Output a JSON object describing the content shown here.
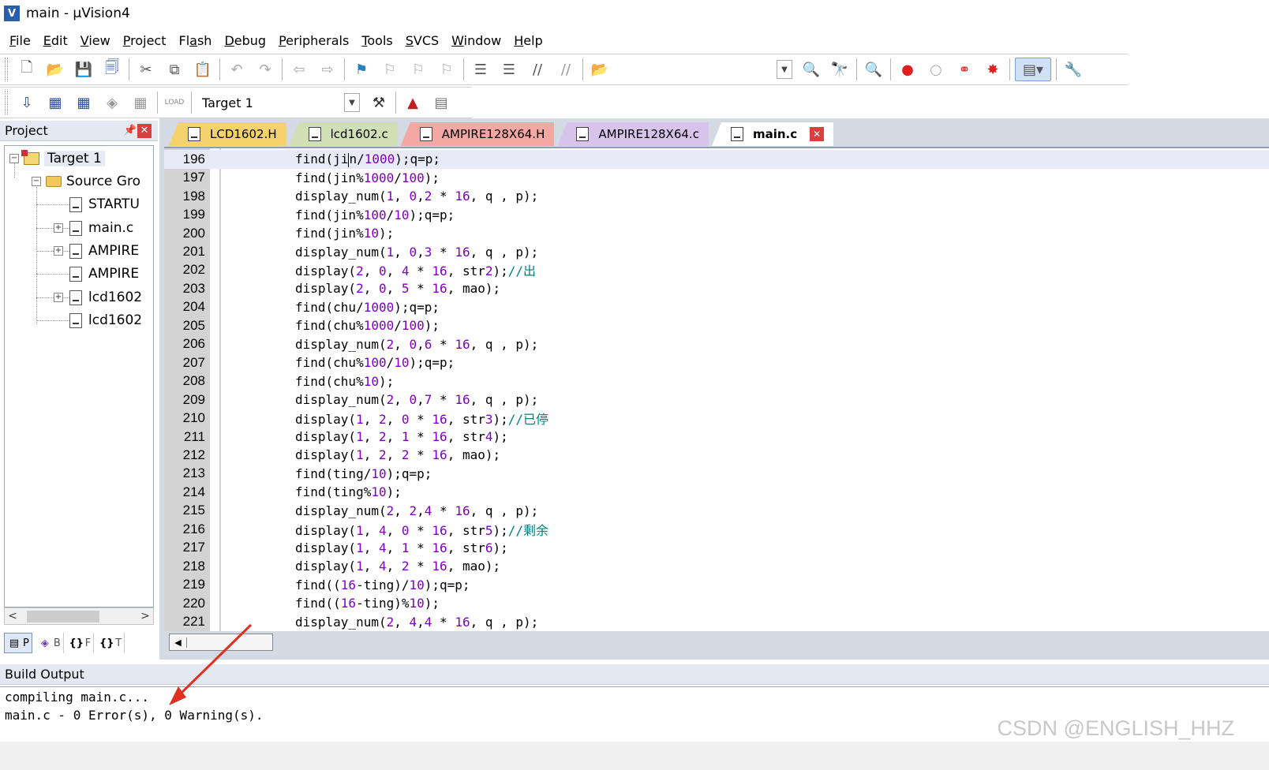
{
  "window": {
    "title": "main  - µVision4",
    "app_icon": "V"
  },
  "menu": [
    {
      "pre": "",
      "u": "F",
      "post": "ile"
    },
    {
      "pre": "",
      "u": "E",
      "post": "dit"
    },
    {
      "pre": "",
      "u": "V",
      "post": "iew"
    },
    {
      "pre": "",
      "u": "P",
      "post": "roject"
    },
    {
      "pre": "Fl",
      "u": "a",
      "post": "sh"
    },
    {
      "pre": "",
      "u": "D",
      "post": "ebug"
    },
    {
      "pre": "",
      "u": "P",
      "post": "eripherals"
    },
    {
      "pre": "",
      "u": "T",
      "post": "ools"
    },
    {
      "pre": "",
      "u": "S",
      "post": "VCS"
    },
    {
      "pre": "",
      "u": "W",
      "post": "indow"
    },
    {
      "pre": "",
      "u": "H",
      "post": "elp"
    }
  ],
  "toolbar2": {
    "target_select": "Target 1"
  },
  "project_panel": {
    "title": "Project",
    "tree": [
      {
        "label": "Target 1",
        "icon": "target-icon"
      },
      {
        "label": "Source Gro",
        "icon": "folder-icon"
      },
      {
        "label": "STARTU",
        "icon": "file-icon"
      },
      {
        "label": "main.c",
        "icon": "file-icon"
      },
      {
        "label": "AMPIRE",
        "icon": "file-icon"
      },
      {
        "label": "AMPIRE",
        "icon": "file-icon"
      },
      {
        "label": "lcd1602",
        "icon": "file-icon"
      },
      {
        "label": "lcd1602",
        "icon": "file-icon"
      }
    ],
    "tabs": [
      "P",
      "B",
      "F",
      "T"
    ]
  },
  "editor_tabs": [
    {
      "label": "LCD1602.H",
      "color": "#f5d26b"
    },
    {
      "label": "lcd1602.c",
      "color": "#cfe0b4"
    },
    {
      "label": "AMPIRE128X64.H",
      "color": "#f4a7a3"
    },
    {
      "label": "AMPIRE128X64.c",
      "color": "#d8c3ea"
    },
    {
      "label": "main.c",
      "color": "#ffffff"
    }
  ],
  "code_lines": [
    {
      "n": "196",
      "t": "find(ji|n/1000);q=p;"
    },
    {
      "n": "197",
      "t": "find(jin%1000/100);"
    },
    {
      "n": "198",
      "t": "display_num(1, 0,2 * 16, q , p);"
    },
    {
      "n": "199",
      "t": "find(jin%100/10);q=p;"
    },
    {
      "n": "200",
      "t": "find(jin%10);"
    },
    {
      "n": "201",
      "t": "display_num(1, 0,3 * 16, q , p);"
    },
    {
      "n": "202",
      "t": "display(2, 0, 4 * 16, str2);//出"
    },
    {
      "n": "203",
      "t": "display(2, 0, 5 * 16, mao);"
    },
    {
      "n": "204",
      "t": "find(chu/1000);q=p;"
    },
    {
      "n": "205",
      "t": "find(chu%1000/100);"
    },
    {
      "n": "206",
      "t": "display_num(2, 0,6 * 16, q , p);"
    },
    {
      "n": "207",
      "t": "find(chu%100/10);q=p;"
    },
    {
      "n": "208",
      "t": "find(chu%10);"
    },
    {
      "n": "209",
      "t": "display_num(2, 0,7 * 16, q , p);"
    },
    {
      "n": "210",
      "t": "display(1, 2, 0 * 16, str3);//已停"
    },
    {
      "n": "211",
      "t": "display(1, 2, 1 * 16, str4);"
    },
    {
      "n": "212",
      "t": "display(1, 2, 2 * 16, mao);"
    },
    {
      "n": "213",
      "t": "find(ting/10);q=p;"
    },
    {
      "n": "214",
      "t": "find(ting%10);"
    },
    {
      "n": "215",
      "t": "display_num(2, 2,4 * 16, q , p);"
    },
    {
      "n": "216",
      "t": "display(1, 4, 0 * 16, str5);//剩余"
    },
    {
      "n": "217",
      "t": "display(1, 4, 1 * 16, str6);"
    },
    {
      "n": "218",
      "t": "display(1, 4, 2 * 16, mao);"
    },
    {
      "n": "219",
      "t": "find((16-ting)/10);q=p;"
    },
    {
      "n": "220",
      "t": "find((16-ting)%10);"
    },
    {
      "n": "221",
      "t": "display_num(2, 4,4 * 16, q , p);"
    }
  ],
  "build_output": {
    "title": "Build Output",
    "lines": [
      "compiling main.c...",
      "main.c - 0 Error(s), 0 Warning(s)."
    ]
  },
  "watermark": "CSDN @ENGLISH_HHZ",
  "annotation_color": "#e03020"
}
